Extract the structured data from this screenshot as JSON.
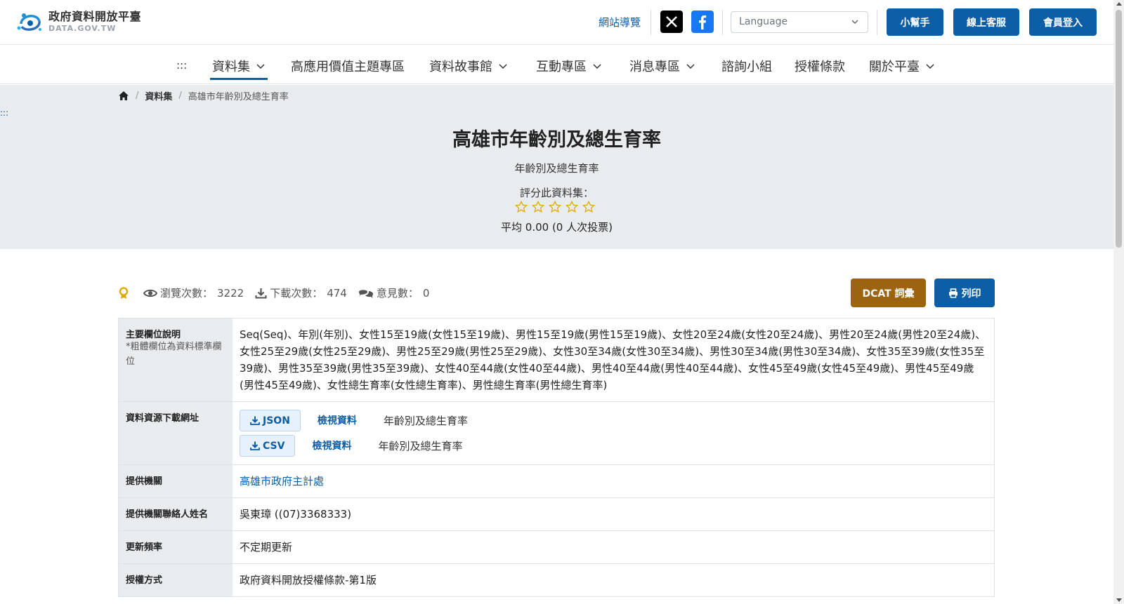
{
  "header": {
    "logo_zh": "政府資料開放平臺",
    "logo_en": "DATA.GOV.TW",
    "sitemap_label": "網站導覽",
    "social": [
      "x-icon",
      "facebook-icon"
    ],
    "language_placeholder": "Language",
    "buttons": {
      "helper": "小幫手",
      "support": "線上客服",
      "login": "會員登入"
    },
    "brand_color": "#0c5fa7"
  },
  "nav": {
    "accesskey": ":::",
    "items": [
      {
        "label": "資料集",
        "dropdown": true,
        "active": true
      },
      {
        "label": "高應用價值主題專區",
        "dropdown": false
      },
      {
        "label": "資料故事館",
        "dropdown": true
      },
      {
        "label": "互動專區",
        "dropdown": true
      },
      {
        "label": "消息專區",
        "dropdown": true
      },
      {
        "label": "諮詢小組",
        "dropdown": false
      },
      {
        "label": "授權條款",
        "dropdown": false
      },
      {
        "label": "關於平臺",
        "dropdown": true
      }
    ]
  },
  "breadcrumb": {
    "home_icon": "home-icon",
    "datasets": "資料集",
    "current": "高雄市年齡別及總生育率"
  },
  "accesskey_center": ":::",
  "dataset": {
    "title": "高雄市年齡別及總生育率",
    "subtitle": "年齡別及總生育率",
    "rate_label": "評分此資料集：",
    "rating_stars": 0,
    "rating_max": 5,
    "average": "平均 0.00 (0 人次投票)"
  },
  "stats": {
    "views_label": "瀏覽次數：",
    "views": "3222",
    "downloads_label": "下載次數：",
    "downloads": "474",
    "comments_label": "意見數：",
    "comments": "0"
  },
  "actions": {
    "dcat": "DCAT 詞彙",
    "print": "列印",
    "dcat_color": "#9c6410"
  },
  "table": {
    "fields": {
      "label": "主要欄位說明",
      "note": "*粗體欄位為資料標準欄位",
      "value": "Seq(Seq)、年別(年別)、女性15至19歲(女性15至19歲)、男性15至19歲(男性15至19歲)、女性20至24歲(女性20至24歲)、男性20至24歲(男性20至24歲)、女性25至29歲(女性25至29歲)、男性25至29歲(男性25至29歲)、女性30至34歲(女性30至34歲)、男性30至34歲(男性30至34歲)、女性35至39歲(女性35至39歲)、男性35至39歲(男性35至39歲)、女性40至44歲(女性40至44歲)、男性40至44歲(男性40至44歲)、女性45至49歲(女性45至49歲)、男性45至49歲(男性45至49歲)、女性總生育率(女性總生育率)、男性總生育率(男性總生育率)"
    },
    "resources": {
      "label": "資料資源下載網址",
      "items": [
        {
          "format": "JSON",
          "view": "檢視資料",
          "desc": "年齡別及總生育率"
        },
        {
          "format": "CSV",
          "view": "檢視資料",
          "desc": "年齡別及總生育率"
        }
      ]
    },
    "provider": {
      "label": "提供機關",
      "value": "高雄市政府主計處"
    },
    "contact": {
      "label": "提供機關聯絡人姓名",
      "value": "吳東璋 ((07)3368333)"
    },
    "frequency": {
      "label": "更新頻率",
      "value": "不定期更新"
    },
    "license": {
      "label": "授權方式",
      "value": "政府資料開放授權條款-第1版"
    }
  }
}
